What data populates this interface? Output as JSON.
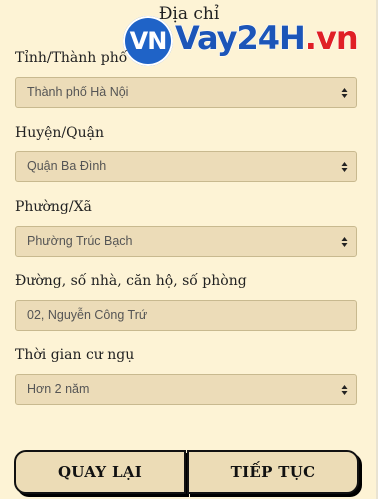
{
  "header": {
    "title": "Địa chỉ"
  },
  "logo": {
    "badge": "VN",
    "brand_blue": "Vay24H",
    "brand_red": ".vn"
  },
  "form": {
    "province": {
      "label": "Tỉnh/Thành phố",
      "value": "Thành phố Hà Nội"
    },
    "district": {
      "label": "Huyện/Quận",
      "value": "Quận Ba Đình"
    },
    "ward": {
      "label": "Phường/Xã",
      "value": "Phường Trúc Bạch"
    },
    "street": {
      "label": "Đường, số nhà, căn hộ, số phòng",
      "value": "02, Nguyễn Công Trứ"
    },
    "residence": {
      "label": "Thời gian cư ngụ",
      "value": "Hơn 2 năm"
    }
  },
  "actions": {
    "back_label": "QUAY LẠI",
    "next_label": "TIẾP TỤC"
  },
  "colors": {
    "background": "#fdf3d5",
    "field": "#ecdcb8",
    "logo_blue": "#1c55b8",
    "logo_red": "#e01f26"
  }
}
